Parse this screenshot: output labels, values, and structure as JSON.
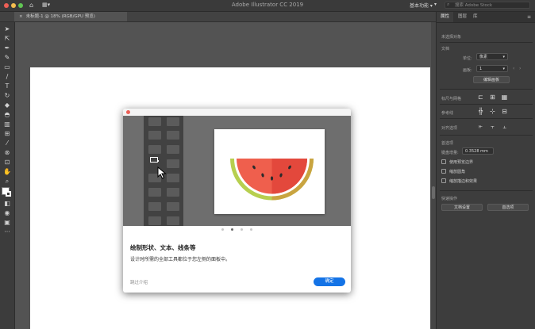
{
  "window": {
    "app_title": "Adobe Illustrator CC 2019",
    "workspace": "基本功能",
    "search_placeholder": "搜索 Adobe Stock"
  },
  "document": {
    "tab_label": "未标题-1 @ 18% (RGB/GPU 预览)"
  },
  "panel": {
    "tabs": [
      "属性",
      "图层",
      "库"
    ],
    "no_selection": "未选择对象",
    "document_section": "文档",
    "units_label": "单位:",
    "units_value": "像素",
    "artboard_label": "画板:",
    "artboard_value": "1",
    "edit_artboard_button": "编辑画板",
    "rulers_grids": "标尺与网格",
    "guides": "参考线",
    "snap": "对齐选项",
    "preferences": "首选项",
    "keyboard_increment_label": "键盘增量:",
    "keyboard_increment_value": "0.3528 mm",
    "check_scale_corners": "使用预览边界",
    "check_scale_strokes": "缩放圆角",
    "check_scale_effects": "缩放描边和效果",
    "quick_actions": "快速操作",
    "doc_setup_button": "文档设置",
    "preferences_button": "首选项"
  },
  "modal": {
    "title": "绘制形状、文本、线条等",
    "description": "设计时所需的全部工具都位于您左侧的面板中。",
    "skip": "跳过介绍",
    "ok": "确定",
    "current_page": 2,
    "page_count": 4
  },
  "colors": {
    "accent": "#1473e6",
    "close": "#ed5f56",
    "melon_red": "#ef5f4d",
    "melon_red_dark": "#e3483c",
    "rind_green": "#b7cf4f",
    "rind_gold": "#c9a440"
  }
}
